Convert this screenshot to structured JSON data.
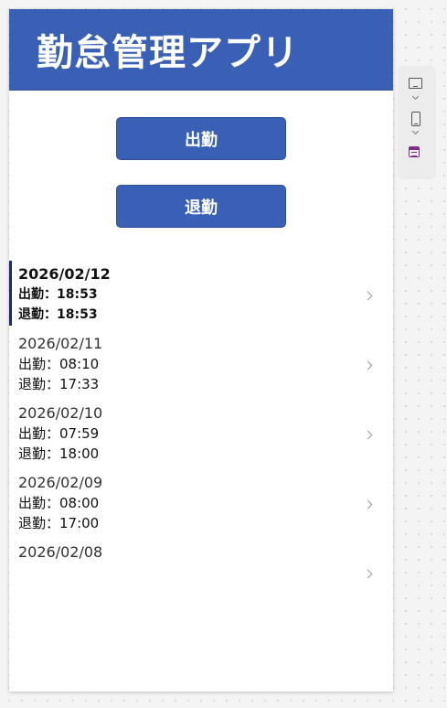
{
  "app": {
    "title": "勤怠管理アプリ",
    "header_color": "#3960b4"
  },
  "buttons": {
    "clock_in": "出勤",
    "clock_out": "退勤"
  },
  "records": [
    {
      "date": "2026/02/12",
      "clock_in": "出勤：18:53",
      "clock_out": "退勤：18:53",
      "selected": true
    },
    {
      "date": "2026/02/11",
      "clock_in": "出勤：08:10",
      "clock_out": "退勤：17:33",
      "selected": false
    },
    {
      "date": "2026/02/10",
      "clock_in": "出勤：07:59",
      "clock_out": "退勤：18:00",
      "selected": false
    },
    {
      "date": "2026/02/09",
      "clock_in": "出勤：08:00",
      "clock_out": "退勤：17:00",
      "selected": false
    },
    {
      "date": "2026/02/08",
      "clock_in": "",
      "clock_out": "",
      "selected": false
    }
  ],
  "toolbar": {
    "icons": [
      "tablet-icon",
      "chevron-down-icon",
      "phone-icon",
      "chevron-down-icon",
      "form-icon"
    ]
  }
}
